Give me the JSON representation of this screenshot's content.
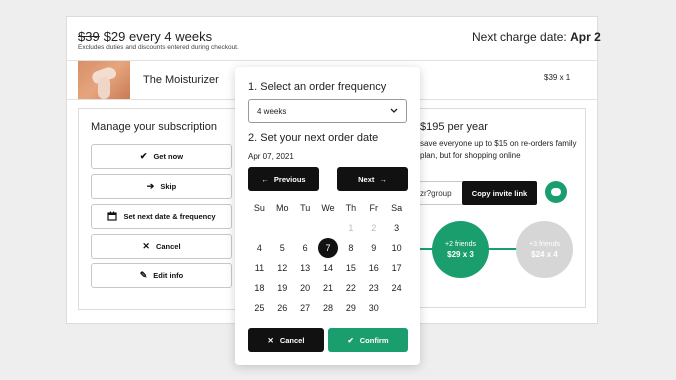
{
  "subscription": {
    "old_price": "$39",
    "price_text": "$29 every 4 weeks",
    "price_note": "Excludes duties and discounts entered during checkout.",
    "next_charge_label": "Next charge date:",
    "next_charge_value": "Apr 2"
  },
  "product": {
    "name": "The Moisturizer",
    "qty": "$39 x 1"
  },
  "manage": {
    "title": "Manage your subscription",
    "buttons": [
      {
        "label": "Get now",
        "icon": "check-icon"
      },
      {
        "label": "Skip",
        "icon": "arrow-right-icon"
      },
      {
        "label": "Set next date & frequency",
        "icon": "calendar-icon"
      },
      {
        "label": "Cancel",
        "icon": "close-icon"
      },
      {
        "label": "Edit info",
        "icon": "pencil-icon"
      }
    ]
  },
  "plan": {
    "title": "$195 per year",
    "desc": "save everyone up to $15 on re-orders family plan, but for shopping online",
    "invite_text": "zr?group",
    "copy_label": "Copy invite link",
    "tiers": [
      {
        "label": "+2 friends",
        "price": "$29 x 3",
        "color": "#1b9e6e"
      },
      {
        "label": "+3 friends",
        "price": "$24 x 4",
        "color": "#d6d6d6"
      }
    ]
  },
  "popup": {
    "frequency_heading": "1. Select an order frequency",
    "frequency_value": "4 weeks",
    "date_heading": "2. Set your next order date",
    "selected_date": "Apr 07, 2021",
    "prev_label": "Previous",
    "next_label": "Next",
    "weekdays": [
      "Su",
      "Mo",
      "Tu",
      "We",
      "Th",
      "Fr",
      "Sa"
    ],
    "weeks": [
      [
        "",
        "",
        "",
        "",
        "1",
        "2",
        "3"
      ],
      [
        "4",
        "5",
        "6",
        "7",
        "8",
        "9",
        "10"
      ],
      [
        "11",
        "12",
        "13",
        "14",
        "15",
        "16",
        "17"
      ],
      [
        "18",
        "19",
        "20",
        "21",
        "22",
        "23",
        "24"
      ],
      [
        "25",
        "26",
        "27",
        "28",
        "29",
        "30",
        ""
      ]
    ],
    "dim_days": [
      "1",
      "2"
    ],
    "selected_day": "7",
    "cancel_label": "Cancel",
    "confirm_label": "Confirm"
  },
  "colors": {
    "accent_green": "#1b9e6e",
    "dark": "#111111"
  }
}
